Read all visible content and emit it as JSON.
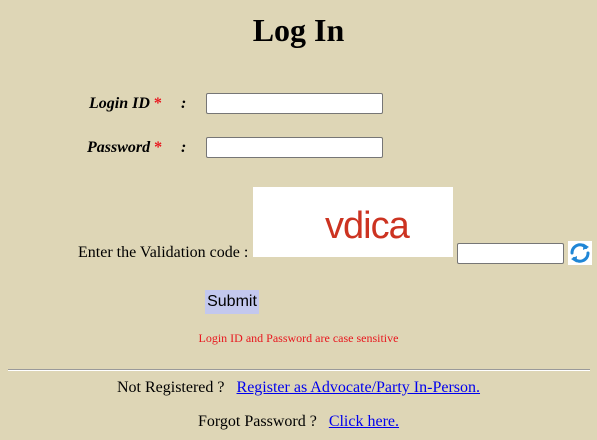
{
  "page": {
    "title": "Log In"
  },
  "form": {
    "login_id": {
      "label": "Login ID",
      "required_mark": "*",
      "colon": ":",
      "value": ""
    },
    "password": {
      "label": "Password",
      "required_mark": "*",
      "colon": ":",
      "value": ""
    },
    "captcha": {
      "label": "Enter the Validation code :",
      "image_text": "vdica",
      "value": ""
    },
    "submit_label": "Submit",
    "case_note": "Login ID and Password are case sensitive"
  },
  "footer": {
    "register": {
      "prompt": "Not Registered ?",
      "link_text": "Register as Advocate/Party In-Person."
    },
    "forgot": {
      "prompt": "Forgot Password ?",
      "link_text": "Click here."
    }
  },
  "colors": {
    "background": "#ded6b6",
    "required": "#e8181f",
    "link": "#0000ee",
    "button": "#c3c8ee"
  },
  "icons": {
    "refresh": "refresh-icon"
  }
}
